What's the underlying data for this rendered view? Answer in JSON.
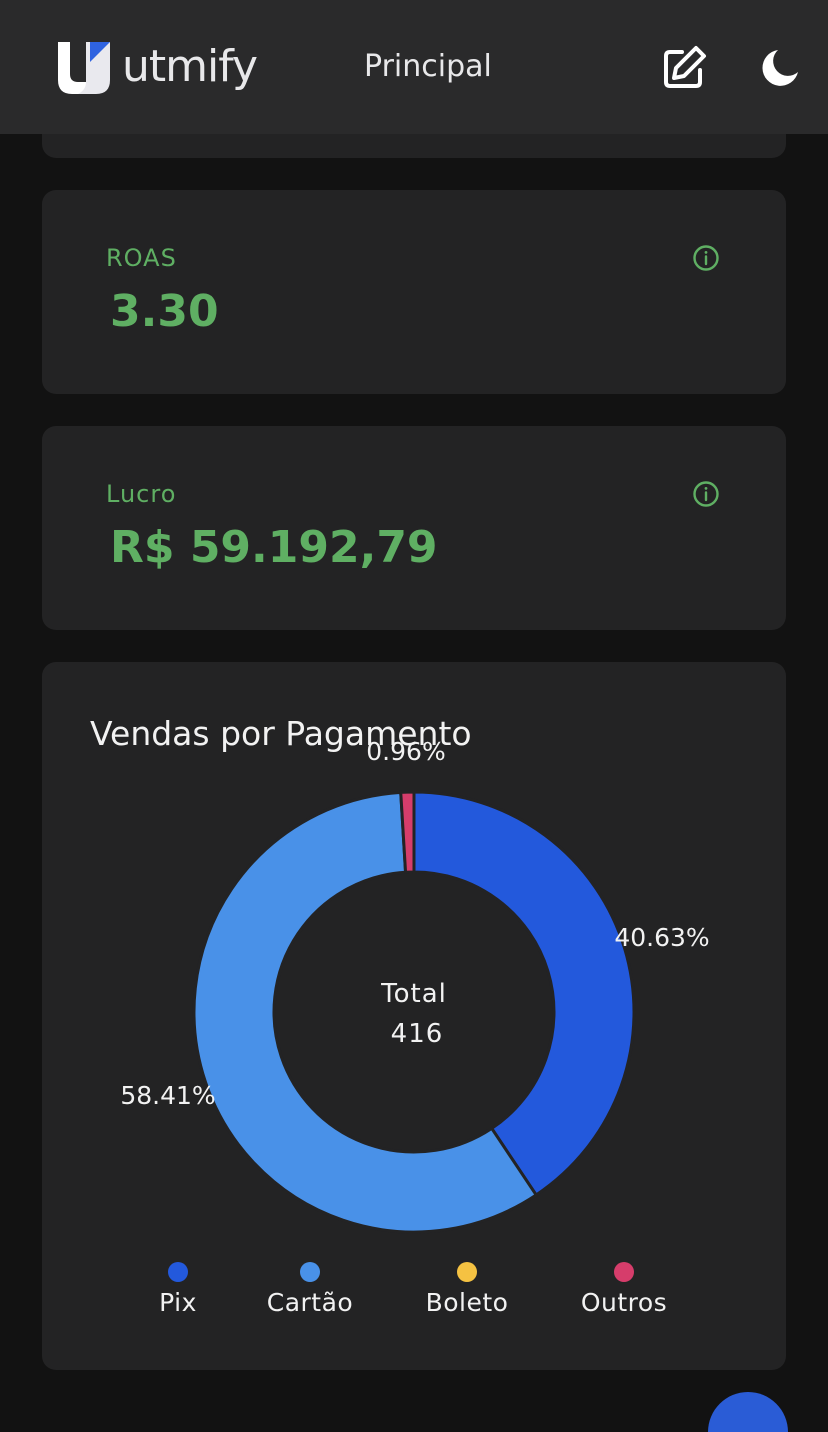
{
  "header": {
    "brand": "utmify",
    "title": "Principal",
    "icons": {
      "edit": "edit-icon",
      "theme": "moon-icon"
    }
  },
  "metrics": [
    {
      "label": "ROAS",
      "value": "3.30",
      "icon": "info-icon"
    },
    {
      "label": "Lucro",
      "value": "R$ 59.192,79",
      "icon": "info-icon"
    }
  ],
  "chart_card": {
    "title": "Vendas por Pagamento",
    "center_label": "Total",
    "center_value": "416"
  },
  "chart_data": {
    "type": "pie",
    "donut": true,
    "title": "Vendas por Pagamento",
    "categories": [
      "Pix",
      "Cartão",
      "Boleto",
      "Outros"
    ],
    "values": [
      40.63,
      58.41,
      0,
      0.96
    ],
    "labels": [
      "40.63%",
      "58.41%",
      "",
      "0.96%"
    ],
    "colors": [
      "#2359dc",
      "#4991e8",
      "#f5c242",
      "#d63d6b"
    ],
    "total_label": "Total",
    "total": 416,
    "legend_position": "bottom"
  },
  "colors": {
    "accent_green": "#5faf63",
    "background": "#121212",
    "card": "#232324",
    "header": "#2a2a2b"
  }
}
